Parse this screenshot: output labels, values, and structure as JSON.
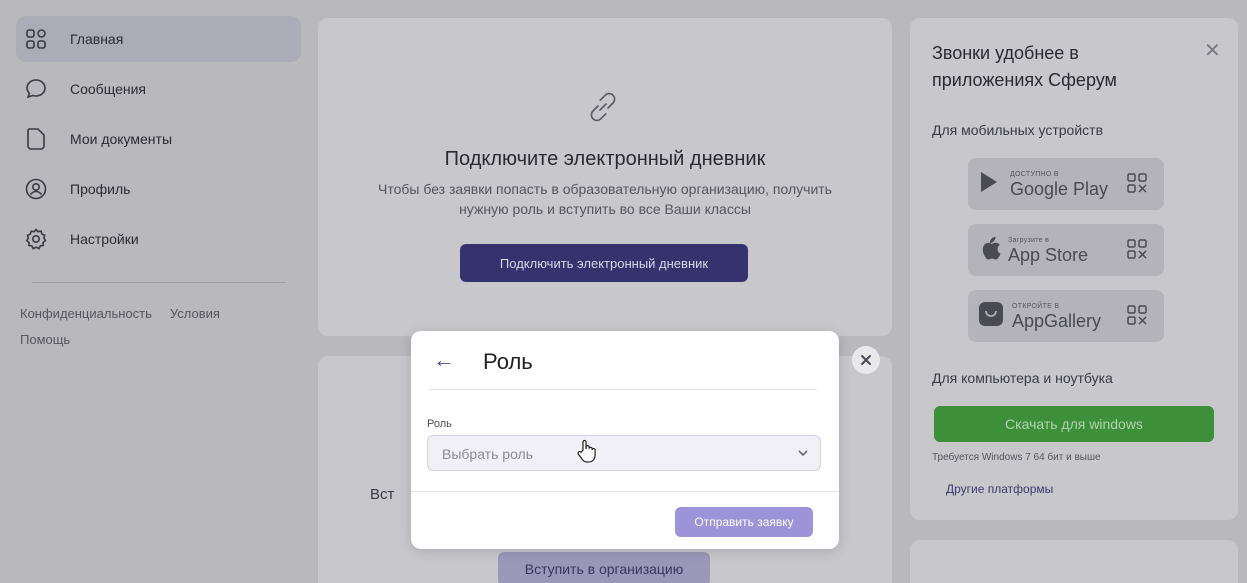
{
  "sidebar": {
    "items": [
      {
        "label": "Главная",
        "icon": "home-grid-icon"
      },
      {
        "label": "Сообщения",
        "icon": "chat-bubble-icon"
      },
      {
        "label": "Мои документы",
        "icon": "document-icon"
      },
      {
        "label": "Профиль",
        "icon": "profile-icon"
      },
      {
        "label": "Настройки",
        "icon": "gear-icon"
      }
    ],
    "links": {
      "privacy": "Конфиденциальность",
      "terms": "Условия",
      "help": "Помощь"
    }
  },
  "diary_card": {
    "title": "Подключите электронный дневник",
    "subtitle": "Чтобы без заявки попасть в образовательную организацию, получить нужную роль и вступить во все Ваши классы",
    "button": "Подключить электронный дневник"
  },
  "org_card": {
    "partial_text": "Вст",
    "button": "Вступить в организацию"
  },
  "apps_panel": {
    "title": "Звонки удобнее в приложениях Сферум",
    "mobile_label": "Для мобильных устройств",
    "stores": [
      {
        "small": "ДОСТУПНО В",
        "big": "Google Play",
        "icon": "google-play-icon"
      },
      {
        "small": "Загрузите в",
        "big": "App Store",
        "icon": "apple-icon"
      },
      {
        "small": "ОТКРОЙТЕ В",
        "big": "AppGallery",
        "icon": "huawei-icon"
      }
    ],
    "pc_label": "Для компьютера и ноутбука",
    "download_button": "Скачать для windows",
    "requirement": "Требуется Windows 7 64 бит и выше",
    "other_platforms": "Другие платформы"
  },
  "modal": {
    "title": "Роль",
    "field_label": "Роль",
    "select_placeholder": "Выбрать роль",
    "submit": "Отправить заявку"
  },
  "colors": {
    "primary": "#36326e",
    "accent_disabled": "#9d93d8",
    "green": "#3d8f3a"
  }
}
